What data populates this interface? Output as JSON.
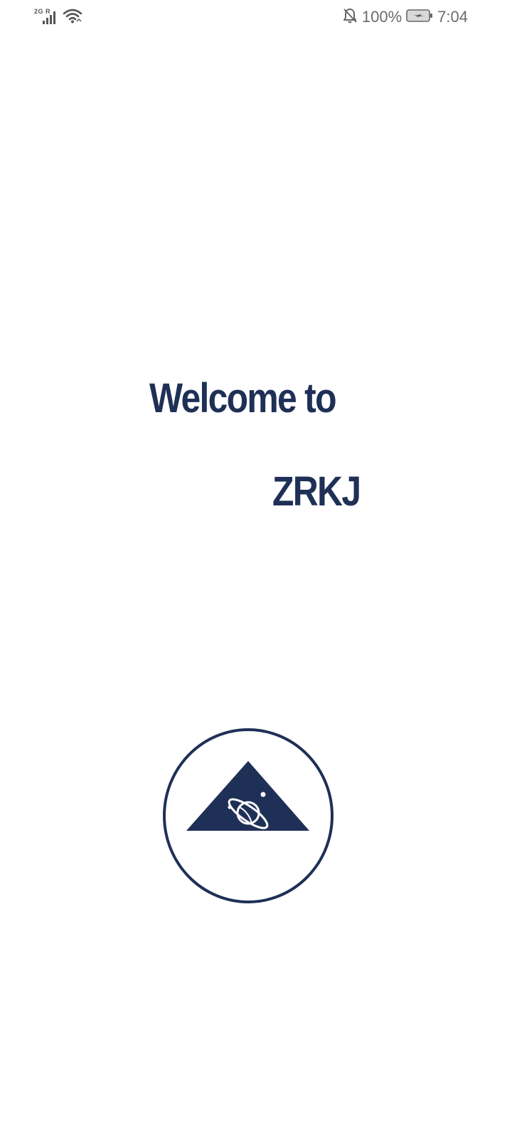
{
  "status_bar": {
    "network_label": "2G R",
    "battery": "100%",
    "time": "7:04",
    "icons": [
      "signal-icon",
      "wifi-icon",
      "mute-bell-icon",
      "battery-charging-icon"
    ]
  },
  "welcome": {
    "line1": "Welcome to",
    "brand": "ZRKJ"
  },
  "logo": {
    "icon": "triangle-planet-logo",
    "color": "#1f3057"
  },
  "colors": {
    "brand": "#1f3057",
    "background": "#ffffff",
    "status_text": "#6b6b6b"
  }
}
